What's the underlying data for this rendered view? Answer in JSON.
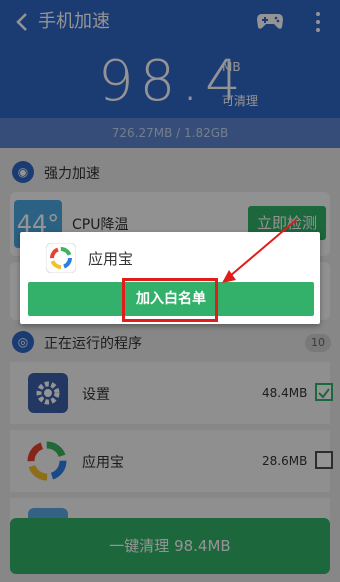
{
  "topbar": {
    "back_icon": "back-arrow-icon",
    "title": "手机加速",
    "game_icon": "gamepad-icon",
    "more_icon": "more-vert-icon"
  },
  "memory": {
    "value": "98.4",
    "unit": "MB",
    "cleanable_label": "可清理",
    "usage": "726.27MB / 1.82GB"
  },
  "boost_section": {
    "icon": "boost-icon",
    "label": "强力加速"
  },
  "cpu_card": {
    "temp": "44°",
    "label": "CPU降温",
    "button": "立即检测"
  },
  "running_section": {
    "icon": "running-icon",
    "label": "正在运行的程序",
    "count": "10"
  },
  "running_apps": [
    {
      "name": "设置",
      "size": "48.4MB",
      "checked": true
    },
    {
      "name": "应用宝",
      "size": "28.6MB",
      "checked": false
    }
  ],
  "bottom_button": "一键清理 98.4MB",
  "popup": {
    "app_name": "应用宝",
    "button": "加入白名单"
  },
  "colors": {
    "brand_blue": "#2f67c6",
    "green": "#33b16a",
    "highlight": "#e21c1c"
  }
}
